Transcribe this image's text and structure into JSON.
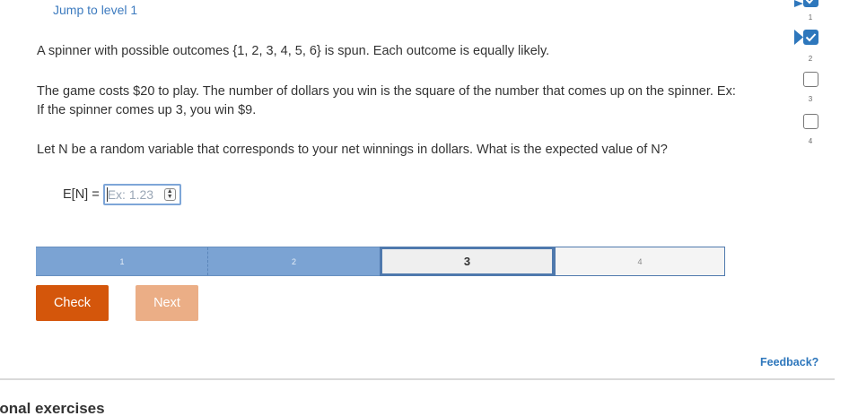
{
  "jump_link": "Jump to level 1",
  "question": {
    "p1": "A spinner with possible outcomes {1, 2, 3, 4, 5, 6} is spun. Each outcome is equally likely.",
    "p2": "The game costs $20 to play. The number of dollars you win is the square of the number that comes up on the spinner. Ex: If the spinner comes up 3, you win $9.",
    "p3": "Let N be a random variable that corresponds to your net winnings in dollars. What is the expected value of N?"
  },
  "answer": {
    "label": "E[N] =",
    "value": "",
    "placeholder": "Ex: 1.23",
    "stepper_icon": "up-down-arrows"
  },
  "progress": {
    "segments": [
      {
        "label": "1",
        "state": "done"
      },
      {
        "label": "2",
        "state": "done"
      },
      {
        "label": "3",
        "state": "current"
      },
      {
        "label": "4",
        "state": "todo"
      }
    ]
  },
  "buttons": {
    "check": "Check",
    "next": "Next"
  },
  "feedback": "Feedback?",
  "levels": [
    {
      "number": "1",
      "state": "done"
    },
    {
      "number": "2",
      "state": "done"
    },
    {
      "number": "3",
      "state": "empty"
    },
    {
      "number": "4",
      "state": "empty"
    }
  ],
  "section_title": "tional exercises",
  "colors": {
    "accent": "#2e77bc",
    "check_button": "#d4560b",
    "next_button": "#ebae86",
    "progress_done": "#7ba3d3"
  }
}
